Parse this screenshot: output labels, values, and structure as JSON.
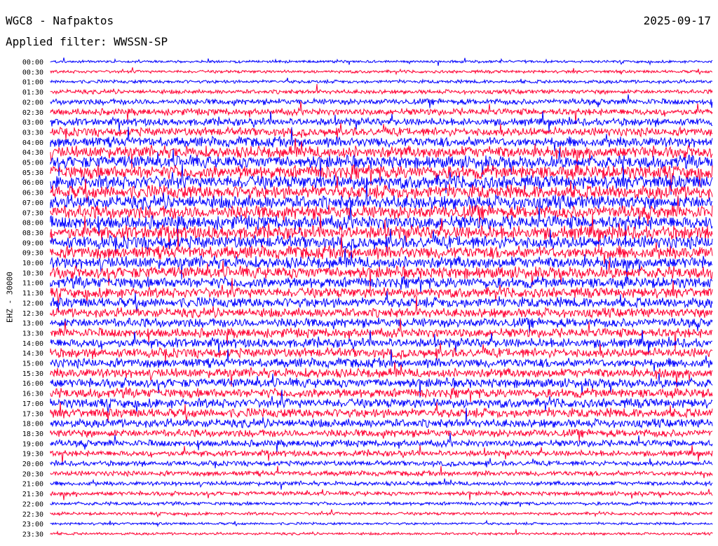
{
  "header": {
    "station": "WGC8 - Nafpaktos",
    "date": "2025-09-17",
    "filter": "Applied filter: WWSSN-SP"
  },
  "chart_data": {
    "type": "line",
    "ylabel": "EHZ - 30000",
    "row_labels": [
      "00:00",
      "00:30",
      "01:00",
      "01:30",
      "02:00",
      "02:30",
      "03:00",
      "03:30",
      "04:00",
      "04:30",
      "05:00",
      "05:30",
      "06:00",
      "06:30",
      "07:00",
      "07:30",
      "08:00",
      "08:30",
      "09:00",
      "09:30",
      "10:00",
      "10:30",
      "11:00",
      "11:30",
      "12:00",
      "12:30",
      "13:00",
      "13:30",
      "14:00",
      "14:30",
      "15:00",
      "15:30",
      "16:00",
      "16:30",
      "17:00",
      "17:30",
      "18:00",
      "18:30",
      "19:00",
      "19:30",
      "20:00",
      "20:30",
      "21:00",
      "21:30",
      "22:00",
      "22:30",
      "23:00",
      "23:30"
    ],
    "colors": [
      "#0000ff",
      "#ff0033"
    ],
    "relative_amplitude": [
      0.3,
      0.35,
      0.4,
      0.5,
      0.7,
      0.8,
      0.9,
      1.0,
      1.2,
      1.4,
      1.5,
      1.6,
      1.6,
      1.6,
      1.6,
      1.6,
      1.6,
      1.6,
      1.5,
      1.5,
      1.4,
      1.4,
      1.3,
      1.2,
      1.2,
      1.1,
      1.1,
      1.1,
      1.1,
      1.1,
      1.1,
      1.1,
      1.1,
      1.1,
      1.1,
      1.1,
      1.0,
      0.9,
      0.8,
      0.7,
      0.6,
      0.6,
      0.5,
      0.5,
      0.4,
      0.35,
      0.3,
      0.3
    ]
  }
}
